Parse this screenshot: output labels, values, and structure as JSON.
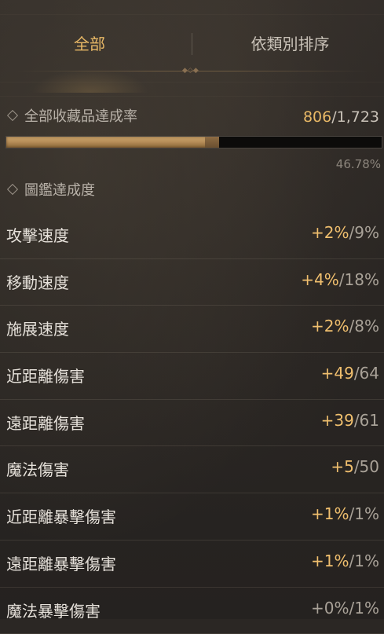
{
  "tabs": [
    {
      "label": "全部",
      "active": true
    },
    {
      "label": "依類別排序",
      "active": false
    }
  ],
  "collection": {
    "title": "全部收藏品達成率",
    "current": "806",
    "total": "/1,723",
    "progress_fraction": 0.4678,
    "percent_text": "46.78%"
  },
  "codex": {
    "title": "圖鑑達成度"
  },
  "stats": [
    {
      "label": "攻擊速度",
      "bonus": "+2%",
      "max": "/9%"
    },
    {
      "label": "移動速度",
      "bonus": "+4%",
      "max": "/18%"
    },
    {
      "label": "施展速度",
      "bonus": "+2%",
      "max": "/8%"
    },
    {
      "label": "近距離傷害",
      "bonus": "+49",
      "max": "/64"
    },
    {
      "label": "遠距離傷害",
      "bonus": "+39",
      "max": "/61"
    },
    {
      "label": "魔法傷害",
      "bonus": "+5",
      "max": "/50"
    },
    {
      "label": "近距離暴擊傷害",
      "bonus": "+1%",
      "max": "/1%"
    },
    {
      "label": "遠距離暴擊傷害",
      "bonus": "+1%",
      "max": "/1%"
    },
    {
      "label": "魔法暴擊傷害",
      "bonus": "+0%",
      "max": "/1%"
    }
  ],
  "colors": {
    "accent_gold": "#e8b866",
    "bonus_gold": "#f0bf6e",
    "text_light": "#e6e1da",
    "background": "#2b2724"
  },
  "icons": [
    "diamond-bullet-icon",
    "tab-ornament-icon"
  ]
}
